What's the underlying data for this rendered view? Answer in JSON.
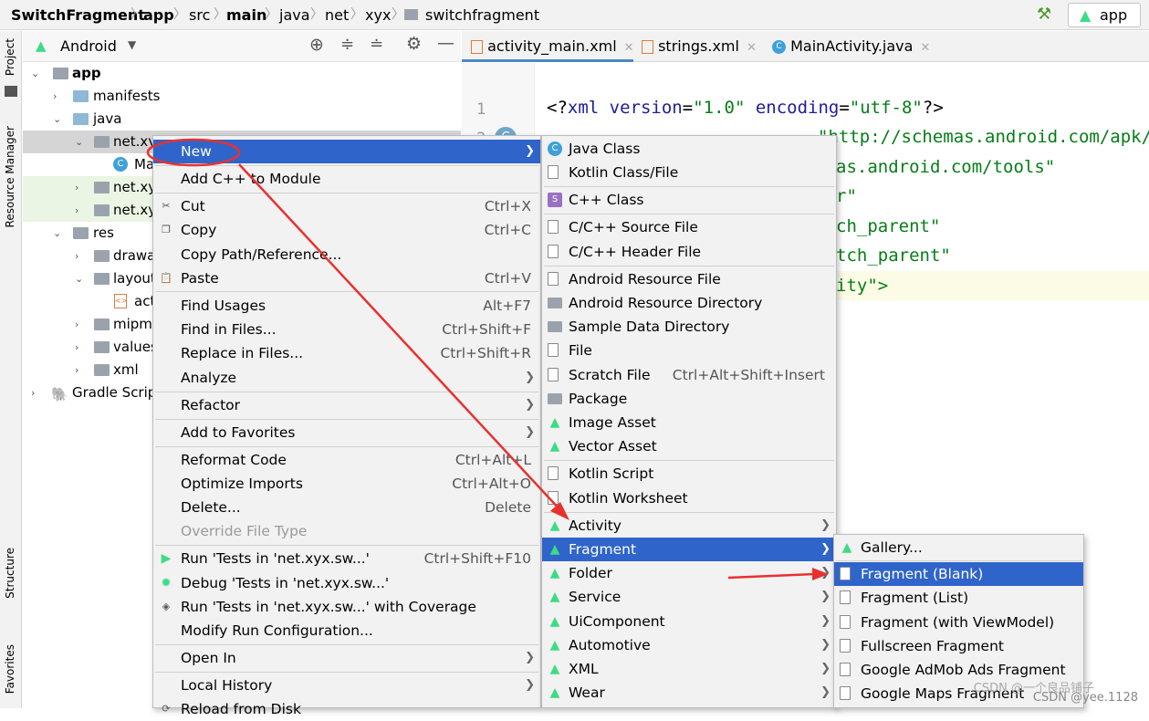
{
  "breadcrumbs": [
    {
      "label": "SwitchFragment",
      "bold": true
    },
    {
      "label": "app",
      "bold": true
    },
    {
      "label": "src",
      "bold": false
    },
    {
      "label": "main",
      "bold": true
    },
    {
      "label": "java",
      "bold": false
    },
    {
      "label": "net",
      "bold": false
    },
    {
      "label": "xyx",
      "bold": false
    },
    {
      "label": "switchfragment",
      "bold": false
    }
  ],
  "toolbar": {
    "run_config": "app",
    "hammer": "hammer-icon"
  },
  "side_tabs": {
    "project": "Project",
    "resource_manager": "Resource Manager",
    "structure": "Structure",
    "favorites": "Favorites"
  },
  "project": {
    "view": "Android",
    "tree": [
      {
        "label": "app",
        "bold": true
      },
      {
        "label": "manifests"
      },
      {
        "label": "java"
      },
      {
        "label": "net.xy"
      },
      {
        "label": "Ma"
      },
      {
        "label": "net.xy"
      },
      {
        "label": "net.xy"
      },
      {
        "label": "res"
      },
      {
        "label": "drawa"
      },
      {
        "label": "layout"
      },
      {
        "label": "act"
      },
      {
        "label": "mipm"
      },
      {
        "label": "values"
      },
      {
        "label": "xml"
      },
      {
        "label": "Gradle Scrip"
      }
    ]
  },
  "tabs": [
    {
      "label": "activity_main.xml",
      "active": true
    },
    {
      "label": "strings.xml",
      "active": false
    },
    {
      "label": "MainActivity.java",
      "active": false
    }
  ],
  "editor": {
    "line_numbers": [
      "1",
      "2"
    ],
    "line1": {
      "a": "<?",
      "b": "xml version",
      "c": "=",
      "d": "\"1.0\"",
      "e": " encoding",
      "f": "=",
      "g": "\"utf-8\"",
      "h": "?>"
    },
    "frag2": "\"http://schemas.android.com/apk/r",
    "frag3": "as.android.com/tools\"",
    "frag4": "r\"",
    "frag5": "ch_parent\"",
    "frag6": "tch_parent\"",
    "frag7": "ity\">"
  },
  "context_menu": [
    {
      "label": "New",
      "shortcut": "",
      "submenu": true,
      "selected": true,
      "icon": ""
    },
    {
      "label": "Add C++ to Module",
      "shortcut": "",
      "icon": ""
    },
    {
      "label": "Cut",
      "shortcut": "Ctrl+X",
      "icon": "scissors-icon"
    },
    {
      "label": "Copy",
      "shortcut": "Ctrl+C",
      "icon": "copy-icon"
    },
    {
      "label": "Copy Path/Reference...",
      "shortcut": "",
      "icon": ""
    },
    {
      "label": "Paste",
      "shortcut": "Ctrl+V",
      "icon": "paste-icon"
    },
    {
      "label": "Find Usages",
      "shortcut": "Alt+F7",
      "icon": ""
    },
    {
      "label": "Find in Files...",
      "shortcut": "Ctrl+Shift+F",
      "icon": ""
    },
    {
      "label": "Replace in Files...",
      "shortcut": "Ctrl+Shift+R",
      "icon": ""
    },
    {
      "label": "Analyze",
      "shortcut": "",
      "submenu": true,
      "icon": ""
    },
    {
      "label": "Refactor",
      "shortcut": "",
      "submenu": true,
      "icon": ""
    },
    {
      "label": "Add to Favorites",
      "shortcut": "",
      "submenu": true,
      "icon": ""
    },
    {
      "label": "Reformat Code",
      "shortcut": "Ctrl+Alt+L",
      "icon": ""
    },
    {
      "label": "Optimize Imports",
      "shortcut": "Ctrl+Alt+O",
      "icon": ""
    },
    {
      "label": "Delete...",
      "shortcut": "Delete",
      "icon": ""
    },
    {
      "label": "Override File Type",
      "shortcut": "",
      "disabled": true,
      "icon": ""
    },
    {
      "label": "Run 'Tests in 'net.xyx.sw...'",
      "shortcut": "Ctrl+Shift+F10",
      "icon": "run-icon"
    },
    {
      "label": "Debug 'Tests in 'net.xyx.sw...'",
      "shortcut": "",
      "icon": "debug-icon"
    },
    {
      "label": "Run 'Tests in 'net.xyx.sw...' with Coverage",
      "shortcut": "",
      "icon": "coverage-icon"
    },
    {
      "label": "Modify Run Configuration...",
      "shortcut": "",
      "icon": ""
    },
    {
      "label": "Open In",
      "shortcut": "",
      "submenu": true,
      "icon": ""
    },
    {
      "label": "Local History",
      "shortcut": "",
      "submenu": true,
      "icon": ""
    },
    {
      "label": "Reload from Disk",
      "shortcut": "",
      "icon": "reload-icon"
    }
  ],
  "new_menu": [
    {
      "label": "Java Class",
      "shortcut": "",
      "icon": "java-class-icon"
    },
    {
      "label": "Kotlin Class/File",
      "shortcut": "",
      "icon": "kotlin-file-icon"
    },
    {
      "label": "C++ Class",
      "shortcut": "",
      "icon": "cpp-class-icon"
    },
    {
      "label": "C/C++ Source File",
      "shortcut": "",
      "icon": "cpp-source-icon"
    },
    {
      "label": "C/C++ Header File",
      "shortcut": "",
      "icon": "cpp-header-icon"
    },
    {
      "label": "Android Resource File",
      "shortcut": "",
      "icon": "resource-file-icon"
    },
    {
      "label": "Android Resource Directory",
      "shortcut": "",
      "icon": "folder-icon"
    },
    {
      "label": "Sample Data Directory",
      "shortcut": "",
      "icon": "folder-icon"
    },
    {
      "label": "File",
      "shortcut": "",
      "icon": "file-icon"
    },
    {
      "label": "Scratch File",
      "shortcut": "Ctrl+Alt+Shift+Insert",
      "icon": "scratch-icon"
    },
    {
      "label": "Package",
      "shortcut": "",
      "icon": "package-icon"
    },
    {
      "label": "Image Asset",
      "shortcut": "",
      "icon": "android-icon"
    },
    {
      "label": "Vector Asset",
      "shortcut": "",
      "icon": "android-icon"
    },
    {
      "label": "Kotlin Script",
      "shortcut": "",
      "icon": "kotlin-file-icon"
    },
    {
      "label": "Kotlin Worksheet",
      "shortcut": "",
      "icon": "kotlin-file-icon"
    },
    {
      "label": "Activity",
      "shortcut": "",
      "submenu": true,
      "icon": "android-icon"
    },
    {
      "label": "Fragment",
      "shortcut": "",
      "submenu": true,
      "selected": true,
      "icon": "android-icon"
    },
    {
      "label": "Folder",
      "shortcut": "",
      "submenu": true,
      "icon": "android-icon"
    },
    {
      "label": "Service",
      "shortcut": "",
      "submenu": true,
      "icon": "android-icon"
    },
    {
      "label": "UiComponent",
      "shortcut": "",
      "submenu": true,
      "icon": "android-icon"
    },
    {
      "label": "Automotive",
      "shortcut": "",
      "submenu": true,
      "icon": "android-icon"
    },
    {
      "label": "XML",
      "shortcut": "",
      "submenu": true,
      "icon": "android-icon"
    },
    {
      "label": "Wear",
      "shortcut": "",
      "submenu": true,
      "icon": "android-icon"
    }
  ],
  "fragment_menu": [
    {
      "label": "Gallery...",
      "icon": "android-icon"
    },
    {
      "label": "Fragment (Blank)",
      "selected": true,
      "icon": "fragment-file-icon"
    },
    {
      "label": "Fragment (List)",
      "icon": "fragment-file-icon"
    },
    {
      "label": "Fragment (with ViewModel)",
      "icon": "fragment-file-icon"
    },
    {
      "label": "Fullscreen Fragment",
      "icon": "fragment-file-icon"
    },
    {
      "label": "Google AdMob Ads Fragment",
      "icon": "fragment-file-icon"
    },
    {
      "label": "Google Maps Fragment",
      "icon": "fragment-file-icon"
    }
  ],
  "watermark": "CSDN @一个良品铺子",
  "watermark2": "CSDN @yee.1128",
  "colors": {
    "selection": "#2f65ca",
    "annotation": "#e8312f",
    "menu_bg": "#f2f2f2"
  }
}
